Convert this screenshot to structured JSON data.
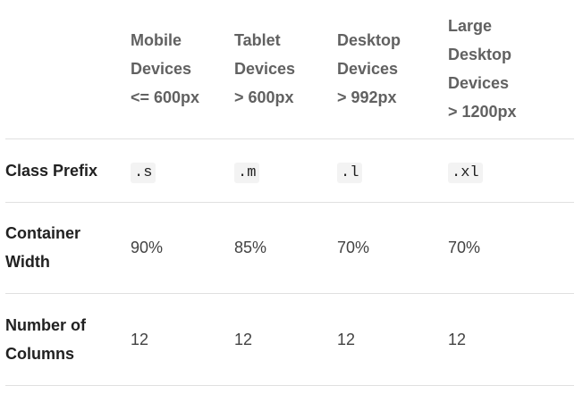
{
  "header": {
    "corner": "",
    "mobile": [
      "Mobile",
      "Devices",
      "<= 600px"
    ],
    "tablet": [
      "Tablet",
      "Devices",
      "> 600px"
    ],
    "desktop": [
      "Desktop",
      "Devices",
      "> 992px"
    ],
    "large_desktop": [
      "Large",
      "Desktop",
      "Devices",
      "> 1200px"
    ]
  },
  "rows": {
    "class_prefix": {
      "label": "Class Prefix",
      "values": [
        ".s",
        ".m",
        ".l",
        ".xl"
      ]
    },
    "container_width": {
      "label": [
        "Container",
        "Width"
      ],
      "values": [
        "90%",
        "85%",
        "70%",
        "70%"
      ]
    },
    "number_of_columns": {
      "label": [
        "Number of",
        "Columns"
      ],
      "values": [
        "12",
        "12",
        "12",
        "12"
      ]
    }
  },
  "colors": {
    "header_text": "#616161",
    "divider": "#e0e0e0",
    "code_background": "#f3f3f3"
  }
}
